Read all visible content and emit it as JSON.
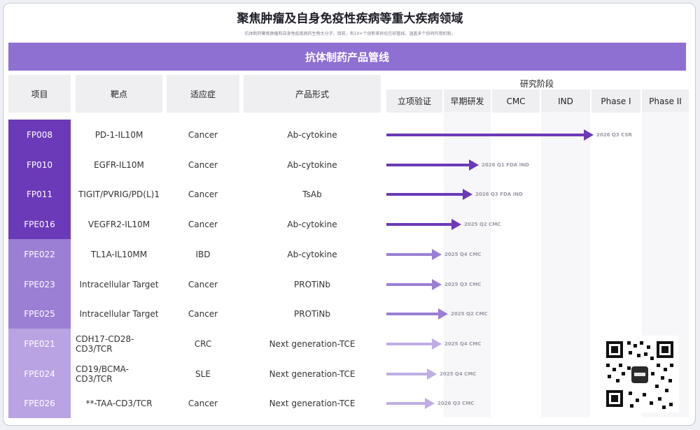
{
  "header": {
    "title": "聚焦肿瘤及自身免疫性疾病等重大疾病领域",
    "subtitle": "抗体制药聚焦肿瘤和自身免疫疾病的生物大分子，目前，有10+个创新差异化在研管线，涵盖多个协同作用机制。"
  },
  "banner": {
    "title": "抗体制药产品管线"
  },
  "columns": {
    "project": "项目",
    "target": "靶点",
    "indication": "适应症",
    "format": "产品形式",
    "stage_group": "研究阶段",
    "stages": [
      "立项验证",
      "早期研发",
      "CMC",
      "IND",
      "Phase I",
      "Phase II"
    ]
  },
  "colors": {
    "banner": "#8e6fd2",
    "tier1": "#6b3ab8",
    "tier2": "#9b7fd4",
    "tier3": "#b9a3e2",
    "arrow1": "#6b3ab8",
    "arrow2": "#9b7fd4",
    "arrow3": "#bfaee6"
  },
  "rows": [
    {
      "id": "FP008",
      "target": "PD-1-IL10M",
      "indication": "Cancer",
      "format": "Ab-cytokine",
      "tier": 1,
      "progress": 0.94,
      "milestone": "2026 Q3 CSR"
    },
    {
      "id": "FP010",
      "target": "EGFR-IL10M",
      "indication": "Cancer",
      "format": "Ab-cytokine",
      "tier": 1,
      "progress": 0.42,
      "milestone": "2026 Q1 FDA IND"
    },
    {
      "id": "FP011",
      "target": "TIGIT/PVRIG/PD(L)1",
      "indication": "Cancer",
      "format": "TsAb",
      "tier": 1,
      "progress": 0.39,
      "milestone": "2026 Q3 FDA IND"
    },
    {
      "id": "FPE016",
      "target": "VEGFR2-IL10M",
      "indication": "Cancer",
      "format": "Ab-cytokine",
      "tier": 1,
      "progress": 0.34,
      "milestone": "2025 Q2 CMC"
    },
    {
      "id": "FPE022",
      "target": "TL1A-IL10MM",
      "indication": "IBD",
      "format": "Ab-cytokine",
      "tier": 2,
      "progress": 0.25,
      "milestone": "2025 Q4 CMC"
    },
    {
      "id": "FPE023",
      "target": "Intracellular Target",
      "indication": "Cancer",
      "format": "PROTiNb",
      "tier": 2,
      "progress": 0.25,
      "milestone": "2025 Q3 CMC"
    },
    {
      "id": "FPE025",
      "target": "Intracellular Target",
      "indication": "Cancer",
      "format": "PROTiNb",
      "tier": 2,
      "progress": 0.28,
      "milestone": "2025 Q2 CMC"
    },
    {
      "id": "FPE021",
      "target": "CDH17-CD28-CD3/TCR",
      "indication": "CRC",
      "format": "Next generation-TCE",
      "tier": 3,
      "progress": 0.25,
      "milestone": "2025 Q4 CMC"
    },
    {
      "id": "FPE024",
      "target": "CD19/BCMA-CD3/TCR",
      "indication": "SLE",
      "format": "Next generation-TCE",
      "tier": 3,
      "progress": 0.23,
      "milestone": "2025 Q4 CMC"
    },
    {
      "id": "FPE026",
      "target": "**-TAA-CD3/TCR",
      "indication": "Cancer",
      "format": "Next generation-TCE",
      "tier": 3,
      "progress": 0.22,
      "milestone": "2026 Q3 CMC"
    }
  ],
  "qr": {
    "icon": "qr-code-icon"
  }
}
